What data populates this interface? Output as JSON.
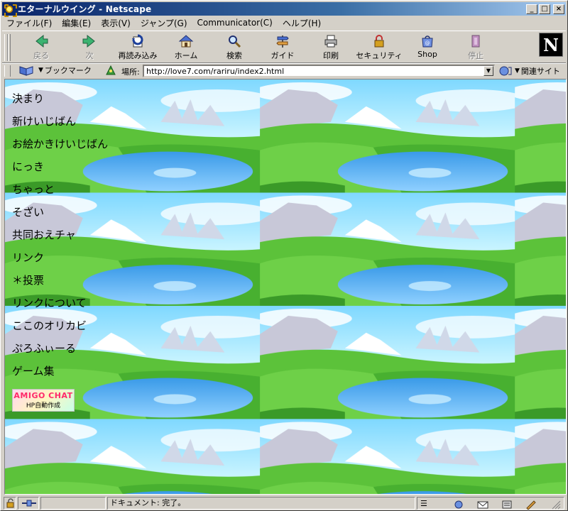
{
  "window": {
    "title": "エターナルウイング - Netscape",
    "controls": {
      "minimize": "_",
      "maximize": "□",
      "close": "×"
    }
  },
  "menu": [
    "ファイル(F)",
    "編集(E)",
    "表示(V)",
    "ジャンプ(G)",
    "Communicator(C)",
    "ヘルプ(H)"
  ],
  "toolbar": {
    "buttons": [
      {
        "label": "戻る",
        "icon": "back-arrow-icon",
        "enabled": false
      },
      {
        "label": "次",
        "icon": "forward-arrow-icon",
        "enabled": false
      },
      {
        "label": "再読み込み",
        "icon": "reload-icon",
        "enabled": true
      },
      {
        "label": "ホーム",
        "icon": "home-icon",
        "enabled": true
      },
      {
        "label": "検索",
        "icon": "search-icon",
        "enabled": true
      },
      {
        "label": "ガイド",
        "icon": "guide-icon",
        "enabled": true
      },
      {
        "label": "印刷",
        "icon": "print-icon",
        "enabled": true
      },
      {
        "label": "セキュリティ",
        "icon": "security-lock-icon",
        "enabled": true
      },
      {
        "label": "Shop",
        "icon": "shop-icon",
        "enabled": true
      },
      {
        "label": "停止",
        "icon": "stop-icon",
        "enabled": false
      }
    ],
    "logo": "N"
  },
  "location": {
    "bookmarks_label": "ブックマーク",
    "location_label": "場所:",
    "url": "http://love7.com/rariru/index2.html",
    "related_label": "関連サイト"
  },
  "page": {
    "nav_links": [
      "決まり",
      "新けいじばん",
      "お絵かきけいじばん",
      "にっき",
      "ちゃっと",
      "そざい",
      "共同おえチャ",
      "リンク",
      "＊投票",
      "リンクについて",
      "ここのオリカビ",
      "ぷろふぃーる",
      "ゲーム集"
    ],
    "banner": {
      "line1": "AMIGO CHAT",
      "line2": "HP自動作成"
    }
  },
  "status": {
    "text": "ドキュメント: 完了。"
  },
  "colors": {
    "title_gradient_start": "#0a246a",
    "title_gradient_end": "#a6caf0",
    "chrome": "#d4d0c8",
    "banner_text": "#ff2a6a"
  }
}
